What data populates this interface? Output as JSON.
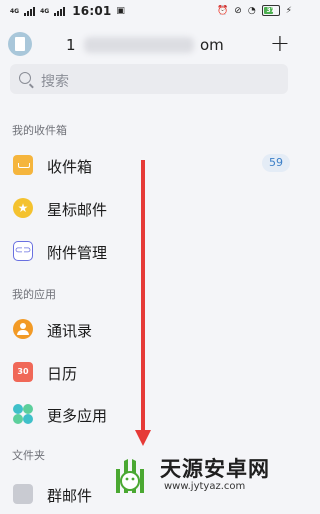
{
  "status_bar": {
    "signal_1": "4G",
    "signal_2": "4G",
    "time": "16:01",
    "battery": "37"
  },
  "header": {
    "account": "1",
    "account_suffix": "om",
    "add_symbol": "+"
  },
  "search": {
    "placeholder": "搜索"
  },
  "sections": {
    "mailbox": "我的收件箱",
    "apps": "我的应用",
    "folders": "文件夹"
  },
  "mailbox_items": [
    {
      "label": "收件箱",
      "icon": "inbox-icon",
      "badge": "59"
    },
    {
      "label": "星标邮件",
      "icon": "star-icon"
    },
    {
      "label": "附件管理",
      "icon": "attachment-icon"
    }
  ],
  "app_items": [
    {
      "label": "通讯录",
      "icon": "contacts-icon"
    },
    {
      "label": "日历",
      "icon": "calendar-icon",
      "icon_text": "30"
    },
    {
      "label": "更多应用",
      "icon": "more-apps-icon"
    }
  ],
  "folder_items": [
    {
      "label": "群邮件",
      "icon": "group-mail-icon"
    }
  ],
  "watermark": {
    "title": "天源安卓网",
    "url": "www.jytyaz.com"
  },
  "colors": {
    "arrow": "#e63a37",
    "badge_text": "#3d80c8",
    "background": "#f4f5f8"
  }
}
